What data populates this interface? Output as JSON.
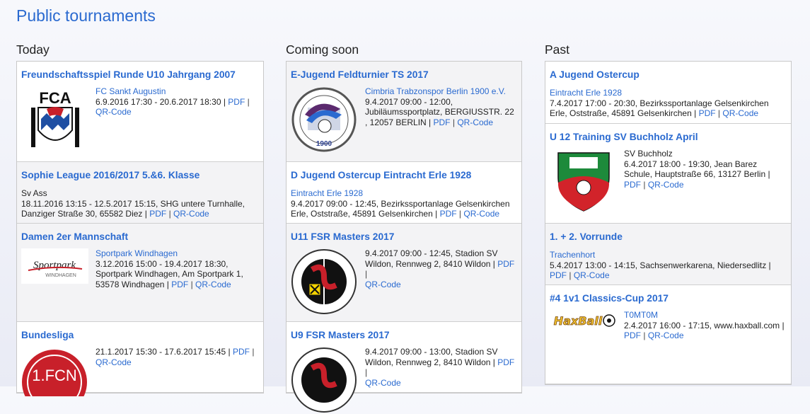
{
  "page_title": "Public tournaments",
  "colors": {
    "link": "#2a6ad0"
  },
  "columns": [
    {
      "heading": "Today",
      "cards": [
        {
          "title": "Freundschaftsspiel Runde U10 Jahrgang 2007",
          "organizer": "FC Sankt Augustin",
          "details": "6.9.2016 17:30 - 20.6.2017 18:30 |",
          "pdf": "PDF",
          "qr": "QR-Code",
          "logo_text": "FCA"
        },
        {
          "title": "Sophie League 2016/2017 5.&6. Klasse",
          "organizer": "Sv Ass",
          "details": "18.11.2016 13:15 - 12.5.2017 15:15, SHG untere Turnhalle, Danziger Straße 30, 65582 Diez |",
          "pdf": "PDF",
          "qr": "QR-Code"
        },
        {
          "title": "Damen 2er Mannschaft",
          "organizer": "Sportpark Windhagen",
          "details": "3.12.2016 15:00 - 19.4.2017 18:30, Sportpark Windhagen, Am Sportpark 1, 53578 Windhagen |",
          "pdf": "PDF",
          "qr": "QR-Code",
          "logo_text": "Sportpark",
          "logo_sub": "WINDHAGEN"
        },
        {
          "title": "Bundesliga",
          "organizer": "",
          "details": "21.1.2017 15:30 - 17.6.2017 15:45 |",
          "pdf": "PDF",
          "qr": "QR-Code",
          "logo_text": "1.FCN"
        }
      ]
    },
    {
      "heading": "Coming soon",
      "cards": [
        {
          "title": "E-Jugend Feldturnier TS 2017",
          "organizer": "Cimbria Trabzonspor Berlin 1900 e.V.",
          "details": "9.4.2017 09:00 - 12:00, Jubiläumssportplatz, BERGIUSSTR. 22 , 12057 BERLIN |",
          "pdf": "PDF",
          "qr": "QR-Code",
          "logo_text": "1900"
        },
        {
          "title": "D Jugend Ostercup Eintracht Erle 1928",
          "organizer": "Eintracht Erle 1928",
          "details": "9.4.2017 09:00 - 12:45, Bezirkssportanlage Gelsenkirchen Erle, Oststraße, 45891 Gelsenkirchen |",
          "pdf": "PDF",
          "qr": "QR-Code"
        },
        {
          "title": "U11 FSR Masters 2017",
          "organizer": "",
          "details": "9.4.2017 09:00 - 12:45, Stadion SV Wildon, Rennweg 2, 8410 Wildon |",
          "pdf": "PDF",
          "qr": "QR-Code"
        },
        {
          "title": "U9 FSR Masters 2017",
          "organizer": "",
          "details": "9.4.2017 09:00 - 13:00, Stadion SV Wildon, Rennweg 2, 8410 Wildon |",
          "pdf": "PDF",
          "qr": "QR-Code"
        }
      ]
    },
    {
      "heading": "Past",
      "cards": [
        {
          "title": "A Jugend Ostercup",
          "organizer": "Eintracht Erle 1928",
          "details": "7.4.2017 17:00 - 20:30, Bezirkssportanlage Gelsenkirchen Erle, Oststraße, 45891 Gelsenkirchen |",
          "pdf": "PDF",
          "qr": "QR-Code"
        },
        {
          "title": "U 12 Training SV Buchholz April",
          "organizer": "SV Buchholz",
          "details": "6.4.2017 18:00 - 19:30, Jean Barez Schule, Hauptstraße 66, 13127 Berlin |",
          "pdf": "PDF",
          "qr": "QR-Code"
        },
        {
          "title": "1. + 2. Vorrunde",
          "organizer": "Trachenhort",
          "details": "5.4.2017 13:00 - 14:15, Sachsenwerkarena, Niedersedlitz |",
          "pdf": "PDF",
          "qr": "QR-Code"
        },
        {
          "title": "#4 1v1 Classics-Cup 2017",
          "organizer": "T0MT0M",
          "details": "2.4.2017 16:00 - 17:15, www.haxball.com |",
          "pdf": "PDF",
          "qr": "QR-Code",
          "logo_text": "HaxBall"
        }
      ]
    }
  ]
}
